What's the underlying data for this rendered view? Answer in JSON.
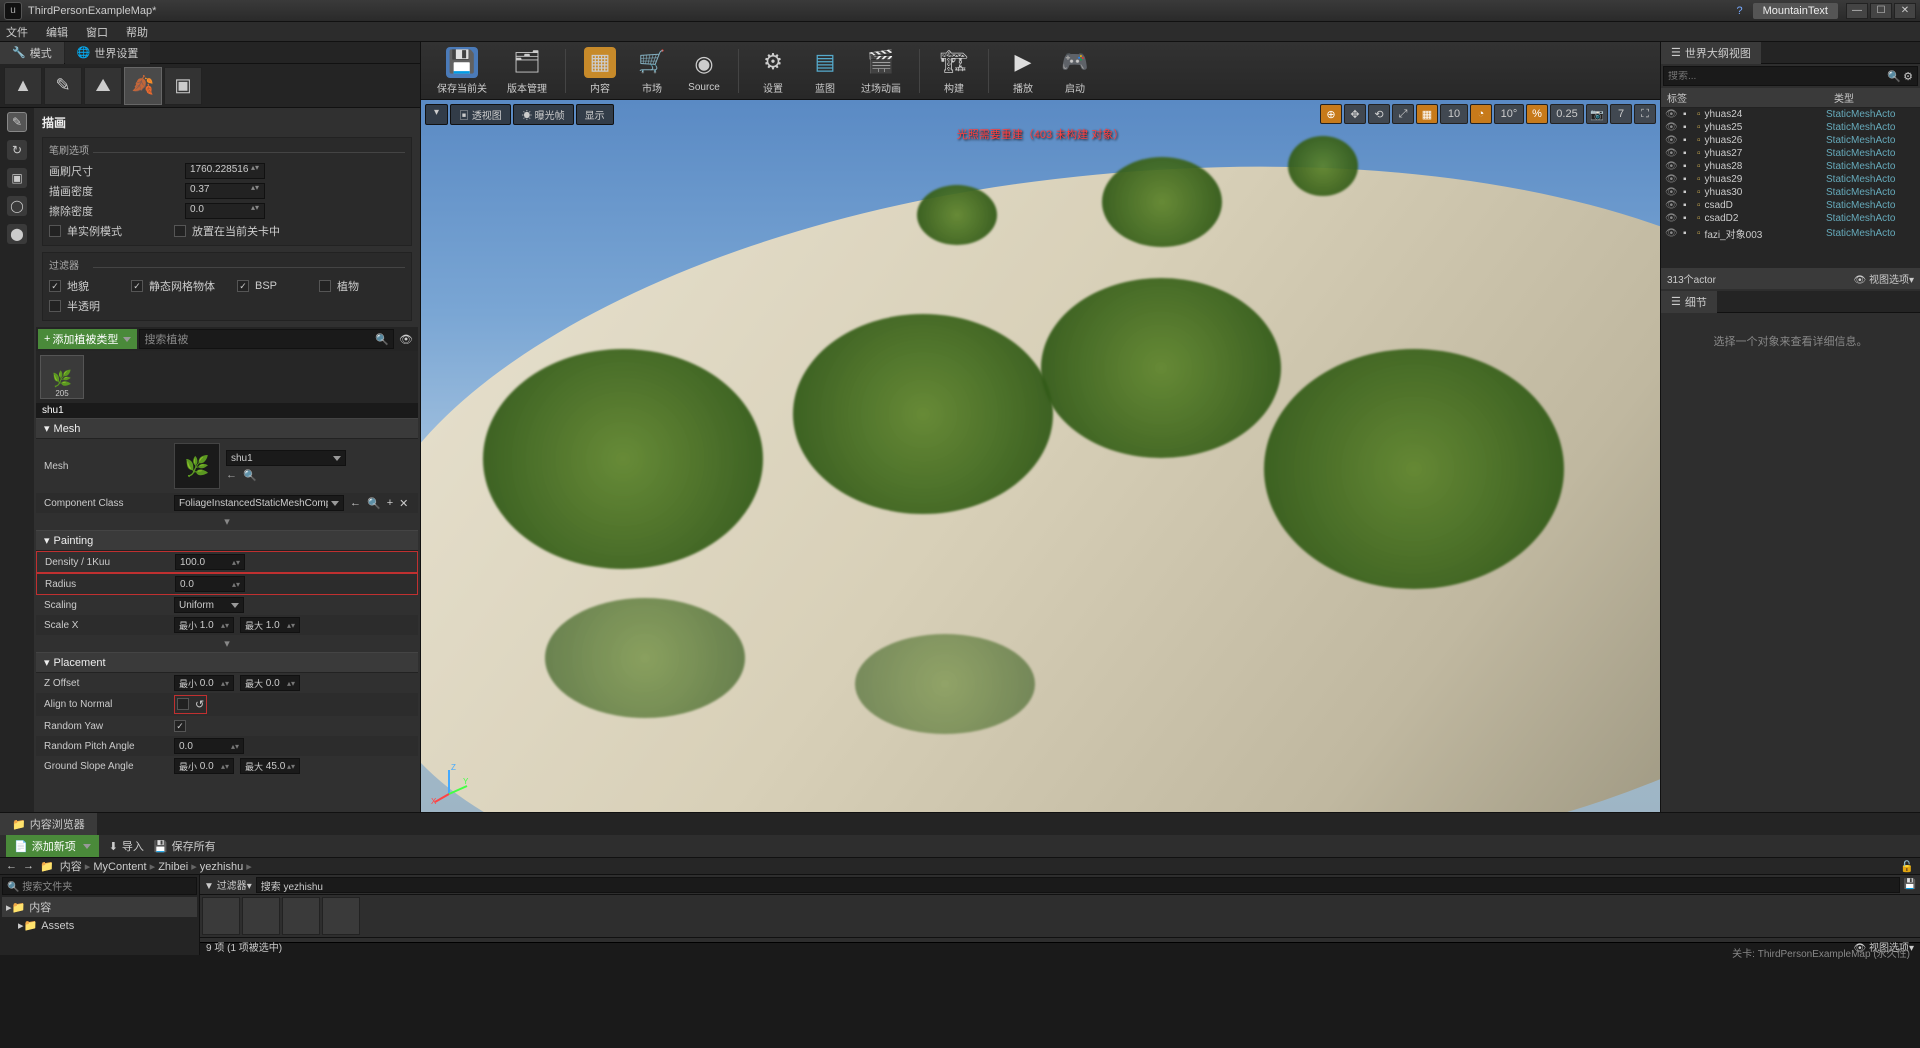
{
  "titlebar": {
    "title": "ThirdPersonExampleMap*",
    "project": "MountainText"
  },
  "menu": {
    "file": "文件",
    "edit": "编辑",
    "window": "窗口",
    "help": "帮助"
  },
  "leftTabs": {
    "modes": "模式",
    "world": "世界设置"
  },
  "paint": {
    "title": "描画",
    "brushOptions": "笔刷选项",
    "brushSize": "画刷尺寸",
    "brushSizeVal": "1760.228516",
    "paintDensity": "描画密度",
    "paintDensityVal": "0.37",
    "eraseDensity": "擦除密度",
    "eraseDensityVal": "0.0",
    "singleInstance": "单实例模式",
    "placeInLevel": "放置在当前关卡中",
    "filters": "过滤器",
    "landscape": "地貌",
    "staticMesh": "静态网格物体",
    "bsp": "BSP",
    "plant": "植物",
    "translucent": "半透明"
  },
  "addFoliage": {
    "btn": "添加植被类型",
    "searchPlaceholder": "搜索植被"
  },
  "foliage": {
    "thumbName": "205",
    "selName": "shu1"
  },
  "details": {
    "meshSection": "Mesh",
    "meshLabel": "Mesh",
    "meshValue": "shu1",
    "compClass": "Component Class",
    "compClassVal": "FoliageInstancedStaticMeshComponent",
    "paintingSection": "Painting",
    "density": "Density / 1Kuu",
    "densityVal": "100.0",
    "radius": "Radius",
    "radiusVal": "0.0",
    "scaling": "Scaling",
    "scalingVal": "Uniform",
    "scaleX": "Scale X",
    "min": "最小",
    "max": "最大",
    "scaleXMin": "1.0",
    "scaleXMax": "1.0",
    "placementSection": "Placement",
    "zOffset": "Z Offset",
    "zOffMin": "0.0",
    "zOffMax": "0.0",
    "alignNormal": "Align to Normal",
    "randomYaw": "Random Yaw",
    "randomPitch": "Random Pitch Angle",
    "randomPitchVal": "0.0",
    "groundSlope": "Ground Slope Angle",
    "slopeMin": "0.0",
    "slopeMax": "45.0"
  },
  "toolbar": {
    "save": "保存当前关",
    "source": "版本管理",
    "content": "内容",
    "market": "市场",
    "sourceBtn": "Source",
    "settings": "设置",
    "blueprint": "蓝图",
    "matinee": "过场动画",
    "build": "构建",
    "play": "播放",
    "launch": "启动"
  },
  "viewport": {
    "perspective": "透视图",
    "lit": "曝光帧",
    "show": "显示",
    "overlay": "光照需要重建（403 未构建 对象）",
    "v10": "10",
    "v10deg": "10°",
    "v025": "0.25",
    "v7": "7"
  },
  "outliner": {
    "title": "世界大纲视图",
    "searchPlaceholder": "搜索...",
    "labelCol": "标签",
    "typeCol": "类型",
    "items": [
      {
        "name": "yhuas24",
        "type": "StaticMeshActo"
      },
      {
        "name": "yhuas25",
        "type": "StaticMeshActo"
      },
      {
        "name": "yhuas26",
        "type": "StaticMeshActo"
      },
      {
        "name": "yhuas27",
        "type": "StaticMeshActo"
      },
      {
        "name": "yhuas28",
        "type": "StaticMeshActo"
      },
      {
        "name": "yhuas29",
        "type": "StaticMeshActo"
      },
      {
        "name": "yhuas30",
        "type": "StaticMeshActo"
      },
      {
        "name": "csadD",
        "type": "StaticMeshActo"
      },
      {
        "name": "csadD2",
        "type": "StaticMeshActo"
      },
      {
        "name": "fazi_对象003",
        "type": "StaticMeshActo"
      }
    ],
    "footer": "313个actor",
    "viewOptions": "视图选项"
  },
  "detailsPanel": {
    "title": "细节",
    "empty": "选择一个对象来查看详细信息。"
  },
  "contentBrowser": {
    "title": "内容浏览器",
    "addNew": "添加新项",
    "import": "导入",
    "saveAll": "保存所有",
    "pathRoot": "内容",
    "crumbs": [
      "内容",
      "MyContent",
      "Zhibei",
      "yezhishu"
    ],
    "searchFolders": "搜索文件夹",
    "treeRoot": "内容",
    "treeAssets": "Assets",
    "filter": "过滤器",
    "searchAssets": "搜索 yezhishu",
    "status": "9 项 (1 项被选中)",
    "viewOptions": "视图选项"
  },
  "statusbar": {
    "level": "关卡: ThirdPersonExampleMap (永久性)"
  }
}
